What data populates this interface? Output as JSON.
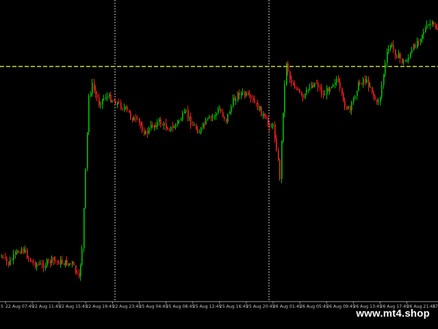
{
  "chart_data": {
    "type": "candlestick",
    "colors": {
      "background": "#000000",
      "bull": "#00c800",
      "bear": "#ff2020",
      "level_line": "#9aa82a",
      "separator": "#d0d0d0",
      "axis_text": "#c8c8c8",
      "axis_line": "#9a9a9a"
    },
    "x_ticks": [
      "22 Aug 07:45",
      "22 Aug 11:45",
      "22 Aug 15:45",
      "22 Aug 19:45",
      "22 Aug 23:45",
      "25 Aug 04:45",
      "25 Aug 08:45",
      "25 Aug 12:45",
      "25 Aug 16:45",
      "25 Aug 20:45",
      "26 Aug 01:45",
      "26 Aug 05:45",
      "26 Aug 09:45",
      "26 Aug 13:45",
      "26 Aug 17:45",
      "26 Aug 21:45"
    ],
    "first_tick_fragment": "5",
    "last_tick_fragment": "27",
    "day_separators_after": [
      "22 Aug 19:45",
      "25 Aug 20:45"
    ],
    "horizontal_level": "dashed level line across the chart",
    "price_path": [
      {
        "i": 0,
        "p": 375
      },
      {
        "i": 4,
        "p": 385
      },
      {
        "i": 8,
        "p": 372
      },
      {
        "i": 12,
        "p": 362
      },
      {
        "i": 18,
        "p": 383
      },
      {
        "i": 24,
        "p": 388
      },
      {
        "i": 30,
        "p": 380
      },
      {
        "i": 36,
        "p": 383
      },
      {
        "i": 42,
        "p": 385
      },
      {
        "i": 46,
        "p": 408
      },
      {
        "i": 48,
        "p": 360
      },
      {
        "i": 50,
        "p": 250
      },
      {
        "i": 52,
        "p": 140
      },
      {
        "i": 54,
        "p": 125
      },
      {
        "i": 58,
        "p": 150
      },
      {
        "i": 62,
        "p": 140
      },
      {
        "i": 66,
        "p": 145
      },
      {
        "i": 70,
        "p": 152
      },
      {
        "i": 74,
        "p": 160
      },
      {
        "i": 78,
        "p": 172
      },
      {
        "i": 82,
        "p": 180
      },
      {
        "i": 86,
        "p": 195
      },
      {
        "i": 90,
        "p": 183
      },
      {
        "i": 94,
        "p": 178
      },
      {
        "i": 98,
        "p": 185
      },
      {
        "i": 102,
        "p": 188
      },
      {
        "i": 106,
        "p": 175
      },
      {
        "i": 110,
        "p": 165
      },
      {
        "i": 114,
        "p": 182
      },
      {
        "i": 118,
        "p": 192
      },
      {
        "i": 122,
        "p": 178
      },
      {
        "i": 126,
        "p": 170
      },
      {
        "i": 130,
        "p": 160
      },
      {
        "i": 134,
        "p": 175
      },
      {
        "i": 138,
        "p": 148
      },
      {
        "i": 142,
        "p": 135
      },
      {
        "i": 146,
        "p": 140
      },
      {
        "i": 150,
        "p": 148
      },
      {
        "i": 154,
        "p": 160
      },
      {
        "i": 158,
        "p": 178
      },
      {
        "i": 162,
        "p": 185
      },
      {
        "i": 164,
        "p": 215
      },
      {
        "i": 166,
        "p": 258
      },
      {
        "i": 168,
        "p": 160
      },
      {
        "i": 170,
        "p": 90
      },
      {
        "i": 172,
        "p": 115
      },
      {
        "i": 176,
        "p": 130
      },
      {
        "i": 180,
        "p": 145
      },
      {
        "i": 184,
        "p": 125
      },
      {
        "i": 188,
        "p": 120
      },
      {
        "i": 192,
        "p": 140
      },
      {
        "i": 196,
        "p": 125
      },
      {
        "i": 200,
        "p": 115
      },
      {
        "i": 204,
        "p": 150
      },
      {
        "i": 208,
        "p": 162
      },
      {
        "i": 212,
        "p": 128
      },
      {
        "i": 216,
        "p": 115
      },
      {
        "i": 220,
        "p": 125
      },
      {
        "i": 224,
        "p": 152
      },
      {
        "i": 226,
        "p": 140
      },
      {
        "i": 228,
        "p": 108
      },
      {
        "i": 230,
        "p": 80
      },
      {
        "i": 232,
        "p": 65
      },
      {
        "i": 236,
        "p": 80
      },
      {
        "i": 240,
        "p": 92
      },
      {
        "i": 244,
        "p": 80
      },
      {
        "i": 248,
        "p": 60
      },
      {
        "i": 252,
        "p": 45
      },
      {
        "i": 256,
        "p": 35
      },
      {
        "i": 260,
        "p": 42
      }
    ],
    "n_bars": 261,
    "seed": 7
  },
  "watermark": "www.mt4.shop"
}
